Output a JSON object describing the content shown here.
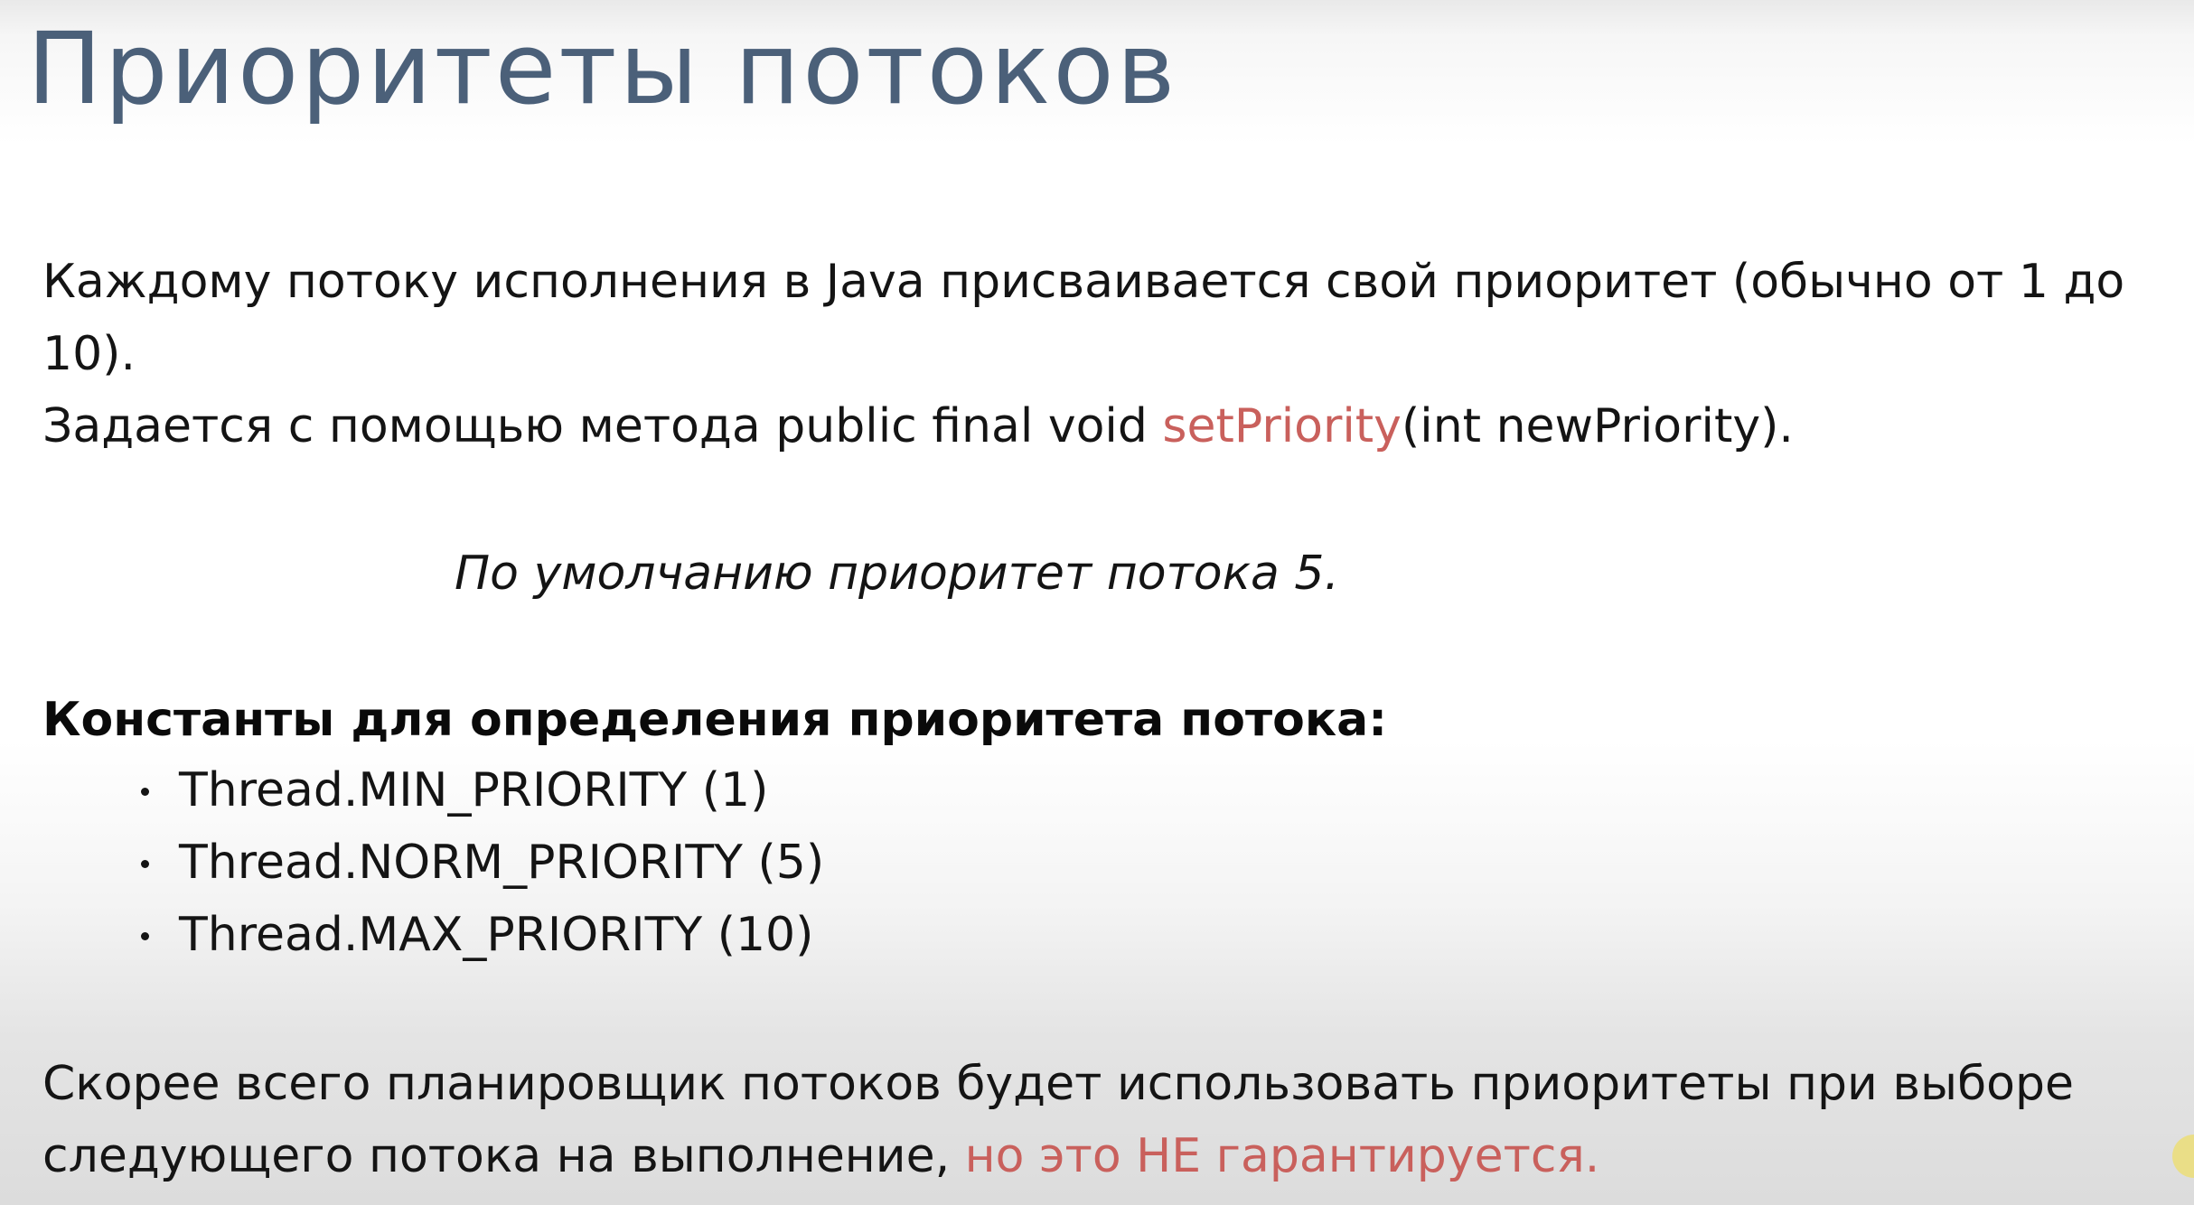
{
  "title": "Приоритеты потоков",
  "paragraph1": {
    "line1": "Каждому потоку исполнения в Java присваивается свой приоритет (обычно от 1 до",
    "line2": "10)."
  },
  "paragraph2": {
    "before": "Задается с помощью метода public final void ",
    "method": "setPriority",
    "after": "(int newPriority)."
  },
  "default_note": "По умолчанию приоритет потока 5.",
  "constants_heading": "Константы для определения приоритета потока:",
  "constants": [
    "Thread.MIN_PRIORITY (1)",
    "Thread.NORM_PRIORITY (5)",
    "Thread.MAX_PRIORITY (10)"
  ],
  "paragraph3": {
    "line1": "Скорее всего планировщик потоков будет использовать приоритеты при выборе",
    "line2_before": "следующего потока на выполнение, ",
    "line2_accent": "но это НЕ гарантируется."
  },
  "colors": {
    "title": "#4b6079",
    "accent": "#c9605c",
    "text": "#141414"
  }
}
